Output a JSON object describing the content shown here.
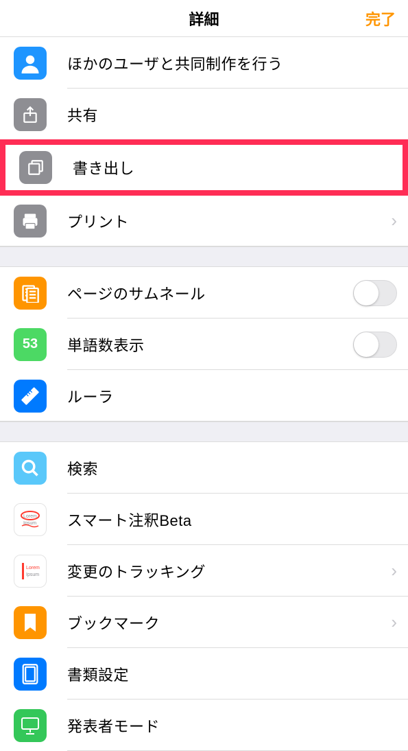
{
  "header": {
    "title": "詳細",
    "done": "完了"
  },
  "section1": {
    "collaborate": "ほかのユーザと共同制作を行う",
    "share": "共有",
    "export": "書き出し",
    "print": "プリント"
  },
  "section2": {
    "thumbnails": "ページのサムネール",
    "wordcount_num": "53",
    "wordcount": "単語数表示",
    "ruler": "ルーラ"
  },
  "section3": {
    "search": "検索",
    "smartannot": "スマート注釈Beta",
    "tracking": "変更のトラッキング",
    "bookmark": "ブックマーク",
    "docsettings": "書類設定",
    "presenter": "発表者モード"
  }
}
